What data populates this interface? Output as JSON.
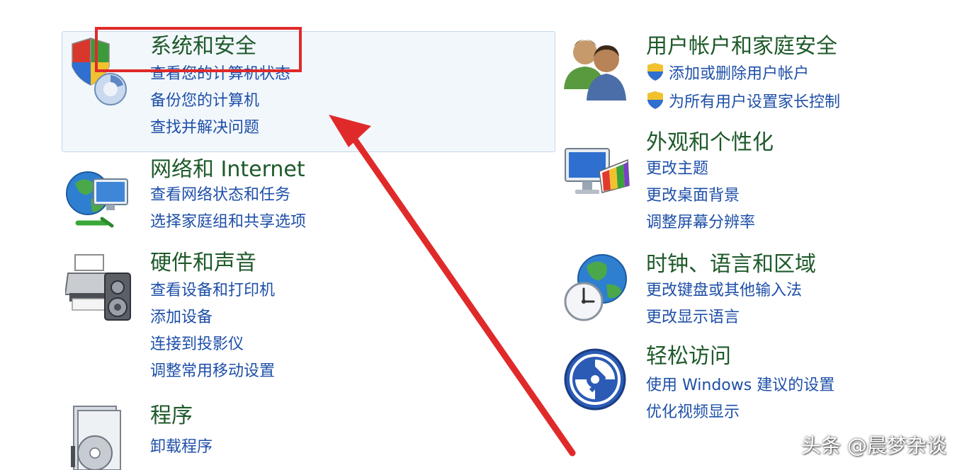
{
  "colors": {
    "title_green": "#1e5a2a",
    "link_blue": "#1e4fa8",
    "annotation_red": "#e02a2a",
    "hover_bg": "#f2f7fc"
  },
  "categories": {
    "system_security": {
      "title": "系统和安全",
      "icon": "security-shield-icon",
      "links": [
        "查看您的计算机状态",
        "备份您的计算机",
        "查找并解决问题"
      ]
    },
    "network": {
      "title": "网络和 Internet",
      "icon": "network-globe-icon",
      "links": [
        "查看网络状态和任务",
        "选择家庭组和共享选项"
      ]
    },
    "hardware": {
      "title": "硬件和声音",
      "icon": "printer-speaker-icon",
      "links": [
        "查看设备和打印机",
        "添加设备",
        "连接到投影仪",
        "调整常用移动设置"
      ]
    },
    "programs": {
      "title": "程序",
      "icon": "programs-disc-icon",
      "links": [
        "卸载程序"
      ]
    },
    "user_accounts": {
      "title": "用户帐户和家庭安全",
      "icon": "users-icon",
      "links": [
        "添加或删除用户帐户",
        "为所有用户设置家长控制"
      ]
    },
    "appearance": {
      "title": "外观和个性化",
      "icon": "monitor-palette-icon",
      "links": [
        "更改主题",
        "更改桌面背景",
        "调整屏幕分辨率"
      ]
    },
    "clock_region": {
      "title": "时钟、语言和区域",
      "icon": "globe-clock-icon",
      "links": [
        "更改键盘或其他输入法",
        "更改显示语言"
      ]
    },
    "ease_access": {
      "title": "轻松访问",
      "icon": "ease-of-access-icon",
      "links": [
        "使用 Windows 建议的设置",
        "优化视频显示"
      ]
    }
  },
  "watermark": "头条 @晨梦杂谈"
}
